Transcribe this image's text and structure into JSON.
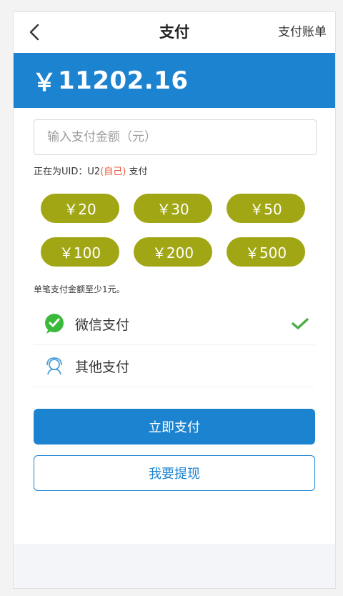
{
  "header": {
    "back_icon": "chevron-left-icon",
    "title": "支付",
    "right_link": "支付账单"
  },
  "balance": {
    "symbol": "￥",
    "amount": "11202.16"
  },
  "amount_input": {
    "placeholder": "输入支付金额（元）",
    "value": ""
  },
  "uid_line": {
    "prefix": "正在为UID：U2",
    "self": "(自己)",
    "suffix": " 支付"
  },
  "presets": [
    {
      "label": "￥20"
    },
    {
      "label": "￥30"
    },
    {
      "label": "￥50"
    },
    {
      "label": "￥100"
    },
    {
      "label": "￥200"
    },
    {
      "label": "￥500"
    }
  ],
  "min_note": "单笔支付金额至少1元。",
  "payment_methods": [
    {
      "label": "微信支付",
      "icon": "wechat-pay-icon",
      "selected": true
    },
    {
      "label": "其他支付",
      "icon": "user-service-icon",
      "selected": false
    }
  ],
  "buttons": {
    "pay_now": "立即支付",
    "withdraw": "我要提现"
  },
  "colors": {
    "primary": "#1c83d1",
    "chip": "#a1a714",
    "highlight": "#e8593c",
    "wechat": "#3ab93a"
  }
}
